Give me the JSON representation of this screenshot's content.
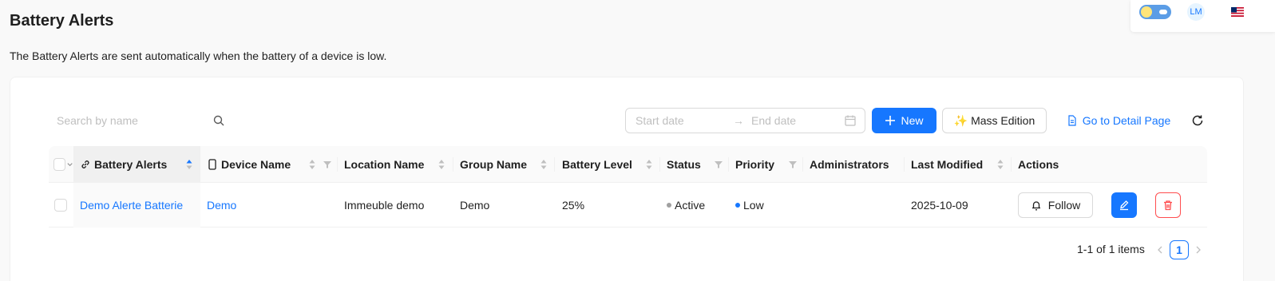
{
  "page": {
    "title": "Battery Alerts",
    "description": "The Battery Alerts are sent automatically when the battery of a device is low."
  },
  "topbar": {
    "avatar_initials": "LM",
    "flag_icon": "us-flag-icon",
    "theme_toggle_icon": "sun-cloud-toggle-icon"
  },
  "toolbar": {
    "search_placeholder": "Search by name",
    "start_date_placeholder": "Start date",
    "end_date_placeholder": "End date",
    "date_arrow": "→",
    "new_label": "New",
    "mass_edition_label": "✨ Mass Edition",
    "detail_label": "Go to Detail Page"
  },
  "table": {
    "columns": [
      {
        "label": "Battery Alerts",
        "sort": "ascending",
        "filter": false
      },
      {
        "label": "Device Name",
        "sort": "none",
        "filter": true
      },
      {
        "label": "Location Name",
        "sort": "none",
        "filter": false
      },
      {
        "label": "Group Name",
        "sort": "none",
        "filter": false
      },
      {
        "label": "Battery Level",
        "sort": "none",
        "filter": false
      },
      {
        "label": "Status",
        "sort": null,
        "filter": true
      },
      {
        "label": "Priority",
        "sort": null,
        "filter": true
      },
      {
        "label": "Administrators",
        "sort": null,
        "filter": false
      },
      {
        "label": "Last Modified",
        "sort": "none",
        "filter": false
      },
      {
        "label": "Actions",
        "sort": null,
        "filter": false
      }
    ],
    "rows": [
      {
        "battery_alert": "Demo Alerte Batterie",
        "device_name": "Demo",
        "location_name": "Immeuble demo",
        "group_name": "Demo",
        "battery_level": "25%",
        "status": "Active",
        "priority": "Low",
        "administrators": "",
        "last_modified": "2025-10-09",
        "follow_label": "Follow"
      }
    ]
  },
  "pagination": {
    "total_text": "1-1 of 1 items",
    "current_page": "1"
  },
  "colors": {
    "primary": "#1677ff",
    "danger": "#ff4d4f",
    "status_active": "#a0a0a0",
    "priority_low": "#1677ff"
  }
}
